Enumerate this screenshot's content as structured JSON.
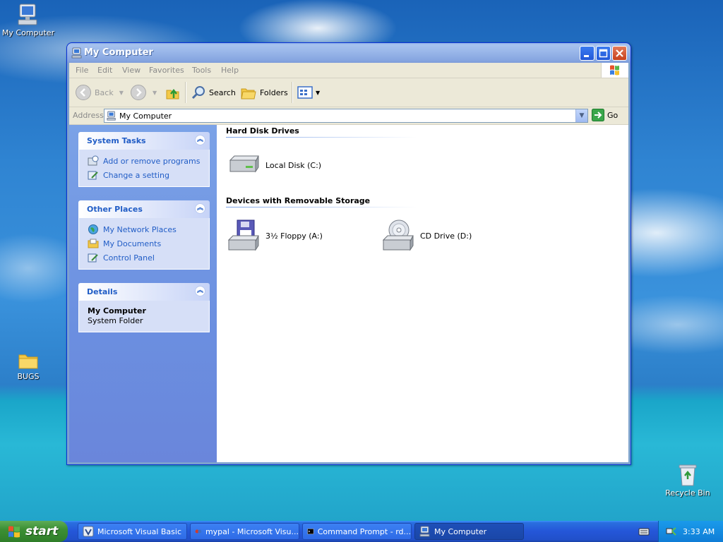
{
  "desktop": {
    "icons": [
      {
        "label": "My Computer"
      },
      {
        "label": "BUGS"
      },
      {
        "label": "Recycle Bin"
      }
    ]
  },
  "window": {
    "title": "My Computer",
    "menu": [
      "File",
      "Edit",
      "View",
      "Favorites",
      "Tools",
      "Help"
    ],
    "toolbar": {
      "back": "Back",
      "search": "Search",
      "folders": "Folders"
    },
    "address": {
      "label": "Address",
      "value": "My Computer",
      "go": "Go"
    },
    "taskpane": {
      "system_tasks": {
        "title": "System Tasks",
        "links": [
          "Add or remove programs",
          "Change a setting"
        ]
      },
      "other_places": {
        "title": "Other Places",
        "links": [
          "My Network Places",
          "My Documents",
          "Control Panel"
        ]
      },
      "details": {
        "title": "Details",
        "name": "My Computer",
        "type": "System Folder"
      }
    },
    "groups": {
      "hard_disk": {
        "title": "Hard Disk Drives",
        "items": [
          "Local Disk (C:)"
        ]
      },
      "removable": {
        "title": "Devices with Removable Storage",
        "items": [
          "3½ Floppy (A:)",
          "CD Drive (D:)"
        ]
      }
    }
  },
  "taskbar": {
    "start": "start",
    "tasks": [
      "Microsoft Visual Basic",
      "mypal - Microsoft Visu...",
      "Command Prompt - rd...",
      "My Computer"
    ],
    "clock": "3:33 AM"
  },
  "colors": {
    "link": "#215dc6",
    "taskpane": "#6b8fe0",
    "taskbar": "#2456d8",
    "start_green": "#3c8f34"
  }
}
